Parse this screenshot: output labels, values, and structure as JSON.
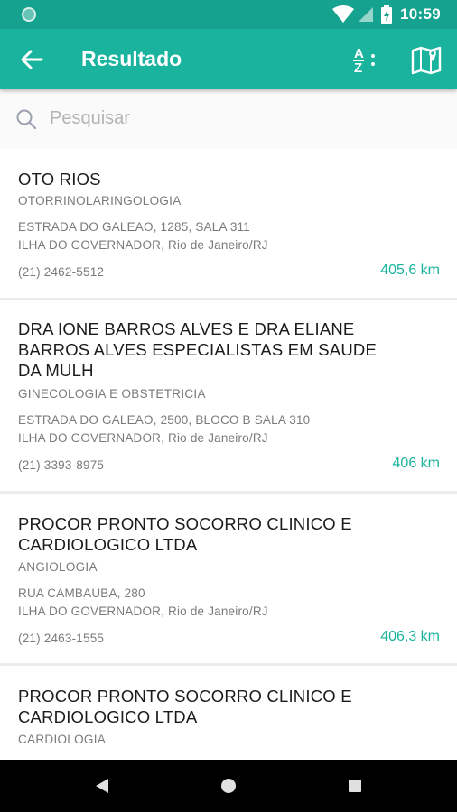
{
  "status_bar": {
    "time": "10:59"
  },
  "app_bar": {
    "title": "Resultado",
    "sort_label_a": "A",
    "sort_label_z": "Z"
  },
  "search": {
    "placeholder": "Pesquisar"
  },
  "results": [
    {
      "name": "OTO RIOS",
      "specialty": "OTORRINOLARINGOLOGIA",
      "address_line1": "ESTRADA DO GALEAO, 1285, SALA 311",
      "address_line2": "ILHA DO GOVERNADOR, Rio de Janeiro/RJ",
      "phone": "(21) 2462-5512",
      "distance": "405,6 km"
    },
    {
      "name": "DRA  IONE BARROS ALVES E DRA  ELIANE BARROS ALVES ESPECIALISTAS EM SAUDE DA MULH",
      "specialty": "GINECOLOGIA E OBSTETRICIA",
      "address_line1": "ESTRADA DO GALEAO, 2500, BLOCO B   SALA 310",
      "address_line2": "ILHA DO GOVERNADOR, Rio de Janeiro/RJ",
      "phone": "(21) 3393-8975",
      "distance": "406 km"
    },
    {
      "name": "PROCOR PRONTO SOCORRO CLINICO E CARDIOLOGICO LTDA",
      "specialty": "ANGIOLOGIA",
      "address_line1": "RUA CAMBAUBA, 280",
      "address_line2": "ILHA DO GOVERNADOR, Rio de Janeiro/RJ",
      "phone": "(21) 2463-1555",
      "distance": "406,3 km"
    },
    {
      "name": "PROCOR PRONTO SOCORRO CLINICO E CARDIOLOGICO LTDA",
      "specialty": "CARDIOLOGIA"
    }
  ],
  "colors": {
    "primary": "#1ab39e",
    "primary_dark": "#15a38f",
    "accent_text": "#1ab39e"
  },
  "icons": [
    "back-arrow-icon",
    "sort-az-icon",
    "map-icon",
    "search-icon",
    "wifi-icon",
    "signal-icon",
    "battery-icon",
    "nav-back-icon",
    "nav-home-icon",
    "nav-recents-icon"
  ]
}
